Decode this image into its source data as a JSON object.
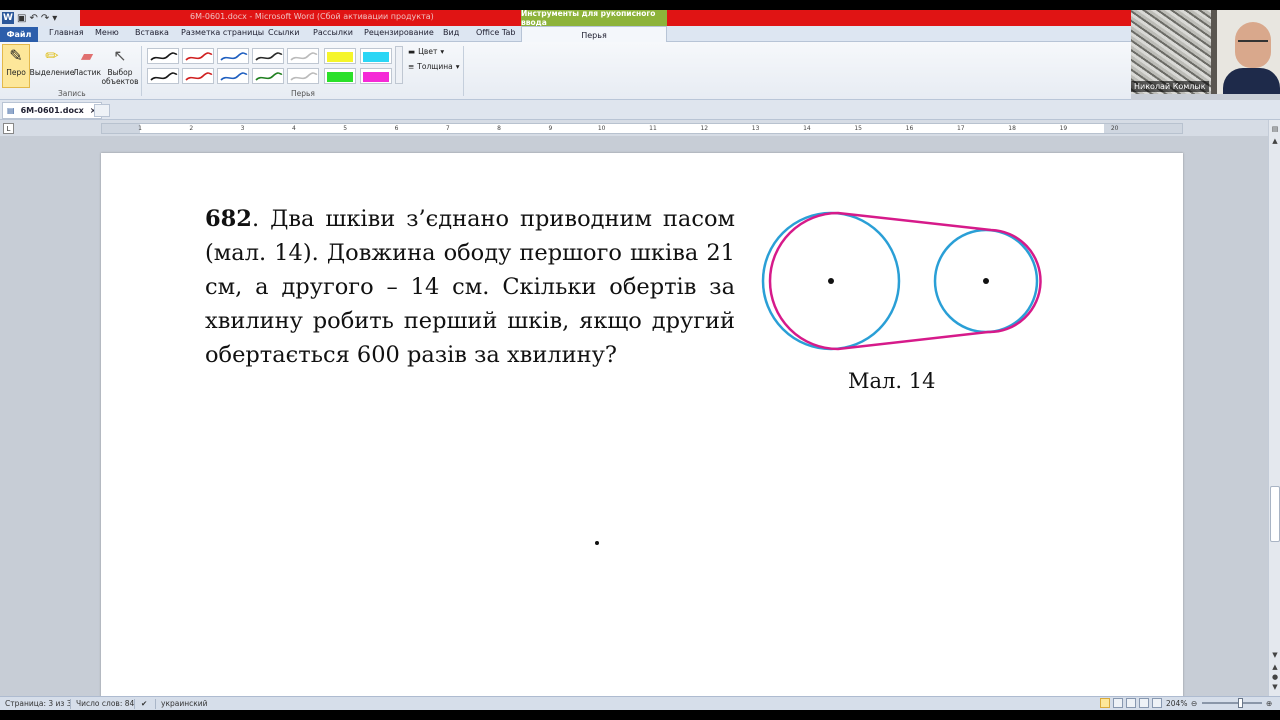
{
  "window": {
    "qat_icon": "W",
    "title": "6M-0601.docx - Microsoft Word (Сбой активации продукта)",
    "context_tools": "Инструменты для рукописного ввода"
  },
  "tabs": {
    "file": "Файл",
    "items": [
      "Главная",
      "Меню",
      "Вставка",
      "Разметка страницы",
      "Ссылки",
      "Рассылки",
      "Рецензирование",
      "Вид",
      "Office Tab"
    ],
    "active": "Перья"
  },
  "ribbon": {
    "record_group": {
      "label": "Запись",
      "buttons": [
        "Перо",
        "Выделение",
        "Ластик",
        "Выбор объектов"
      ]
    },
    "pens_group": {
      "label": "Перья",
      "pen_colors": [
        "#1a1a1a",
        "#d02020",
        "#2060c0",
        "#2a2a2a",
        "#bbbbbb",
        "#1a1a1a",
        "#d02020",
        "#2060c0",
        "#208020",
        "#bbbbbb"
      ],
      "highlighters": [
        "#f5f52a",
        "#2ad6f5",
        "#2ae02a",
        "#f52ad6"
      ]
    },
    "color_label": "Цвет",
    "thickness_label": "Толщина"
  },
  "webcam": {
    "name": "Николай Комлык"
  },
  "doc_tab": {
    "label": "6M-0601.docx",
    "close": "×"
  },
  "ruler": {
    "corner": "L",
    "numbers": [
      "2",
      "1",
      "1",
      "2",
      "3",
      "4",
      "5",
      "6",
      "7",
      "8",
      "9",
      "10",
      "11",
      "12",
      "13",
      "14",
      "15",
      "16",
      "17",
      "18",
      "19",
      "20"
    ]
  },
  "document": {
    "problem_number": "682",
    "problem_text": ". Два шківи з’єднано приводним пасом (мал. 14). Довжина ободу першого шківа 21 см, а другого – 14 см. Скільки обертів за хвилину робить перший шків, якщо другий обертається 600 разів за хвилину?",
    "figure_caption": "Мал. 14",
    "colors": {
      "belt": "#d61a8a",
      "pulley": "#2a9fd6"
    }
  },
  "statusbar": {
    "page": "Страница: 3 из 3",
    "words": "Число слов: 84",
    "language": "украинский",
    "zoom": "204%"
  }
}
